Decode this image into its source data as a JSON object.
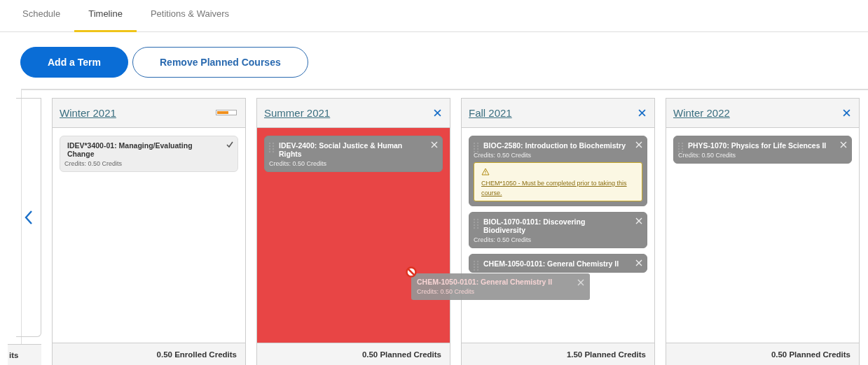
{
  "tabs": [
    {
      "label": "Schedule",
      "selected": false
    },
    {
      "label": "Timeline",
      "selected": true
    },
    {
      "label": "Petitions & Waivers",
      "selected": false
    }
  ],
  "buttons": [
    {
      "label": "Add a Term",
      "kind": "primary"
    },
    {
      "label": "Remove Planned Courses",
      "kind": "outline"
    }
  ],
  "partial_term": {
    "footer": "its"
  },
  "terms": [
    {
      "title": "Winter 2021",
      "kind": "enrolled",
      "drop_blocked": false,
      "footer": "0.50 Enrolled Credits",
      "courses": [
        {
          "name": "IDEV*3400-01: Managing/Evaluating Change",
          "credits": "Credits: 0.50 Credits",
          "kind": "enrolled"
        }
      ]
    },
    {
      "title": "Summer 2021",
      "kind": "planned",
      "drop_blocked": true,
      "footer": "0.50 Planned Credits",
      "courses": [
        {
          "name": "IDEV-2400: Social Justice & Human Rights",
          "credits": "Credits: 0.50 Credits",
          "kind": "planned"
        }
      ]
    },
    {
      "title": "Fall 2021",
      "kind": "planned",
      "drop_blocked": false,
      "footer": "1.50 Planned Credits",
      "courses": [
        {
          "name": "BIOC-2580: Introduction to Biochemistry",
          "credits": "Credits: 0.50 Credits",
          "kind": "planned",
          "warning": "CHEM*1050 - Must be completed prior to taking this course."
        },
        {
          "name": "BIOL-1070-0101: Discovering Biodiversity",
          "credits": "Credits: 0.50 Credits",
          "kind": "planned"
        },
        {
          "name": "CHEM-1050-0101: General Chemistry II",
          "kind": "planned"
        }
      ]
    },
    {
      "title": "Winter 2022",
      "kind": "planned",
      "drop_blocked": false,
      "footer": "0.50 Planned Credits",
      "courses": [
        {
          "name": "PHYS-1070: Physics for Life Sciences II",
          "credits": "Credits: 0.50 Credits",
          "kind": "planned"
        }
      ]
    }
  ],
  "drag_ghost": {
    "name": "CHEM-1050-0101: General Chemistry II",
    "credits": "Credits: 0.50 Credits"
  }
}
